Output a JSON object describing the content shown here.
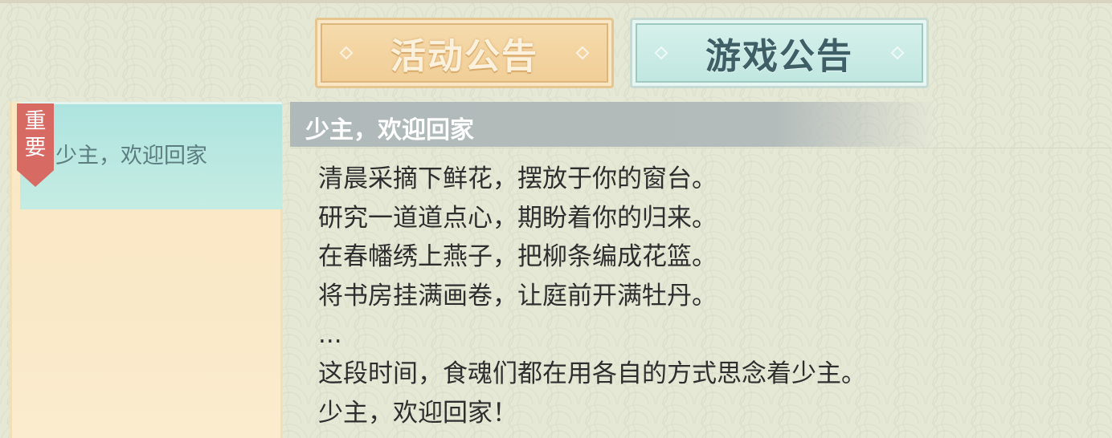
{
  "tabs": [
    {
      "label": "活动公告",
      "state": "inactive",
      "color": "#f0cd95"
    },
    {
      "label": "游戏公告",
      "state": "active",
      "color": "#bfe6e0"
    }
  ],
  "notice_list": {
    "items": [
      {
        "badge": "重要",
        "title": "少主，欢迎回家",
        "selected": true
      }
    ]
  },
  "notice": {
    "title": "少主，欢迎回家",
    "lines": [
      "清晨采摘下鲜花，摆放于你的窗台。",
      "研究一道道点心，期盼着你的归来。",
      "在春幡绣上燕子，把柳条编成花篮。",
      "将书房挂满画卷，让庭前开满牡丹。",
      "...",
      "这段时间，食魂们都在用各自的方式思念着少主。",
      "少主，欢迎回家！"
    ]
  }
}
